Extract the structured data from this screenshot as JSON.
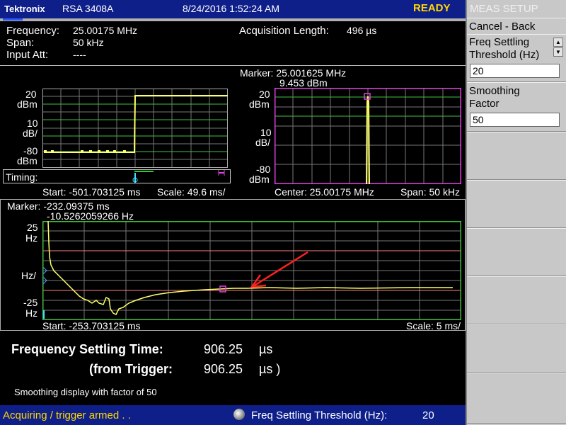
{
  "titlebar": {
    "brand": "Tektronix",
    "model": "RSA 3408A",
    "datetime": "8/24/2016 1:52:24 AM",
    "status": "READY"
  },
  "settings": {
    "frequency_label": "Frequency:",
    "frequency_value": "25.00175 MHz",
    "span_label": "Span:",
    "span_value": "50 kHz",
    "input_att_label": "Input Att:",
    "input_att_value": "----",
    "acq_label": "Acquisition Length:",
    "acq_value": "496 µs"
  },
  "timing_plot": {
    "y_top": "20",
    "y_top_unit": "dBm",
    "y_mid": "10",
    "y_mid_unit": "dB/",
    "y_bot": "-80",
    "y_bot_unit": "dBm",
    "timing_label": "Timing:",
    "start": "Start: -501.703125 ms",
    "scale": "Scale: 49.6 ms/"
  },
  "spectrum_plot": {
    "marker_line1": "Marker: 25.001625 MHz",
    "marker_line2": "9.453 dBm",
    "y_top": "20",
    "y_top_unit": "dBm",
    "y_mid": "10",
    "y_mid_unit": "dB/",
    "y_bot": "-80",
    "y_bot_unit": "dBm",
    "center": "Center: 25.00175 MHz",
    "span": "Span: 50 kHz"
  },
  "settling_plot": {
    "marker_line1": "Marker: -232.09375 ms",
    "marker_line2": "-10.5262059266 Hz",
    "y_top": "25",
    "y_top_unit": "Hz",
    "y_mid_unit": "Hz/",
    "y_bot": "-25",
    "y_bot_unit": "Hz",
    "start": "Start: -253.703125 ms",
    "scale": "Scale: 5 ms/"
  },
  "results": {
    "fst_label": "Frequency Settling Time:",
    "fst_value": "906.25",
    "fst_unit": "µs",
    "trig_label": "(from Trigger:",
    "trig_value": "906.25",
    "trig_unit": "µs )",
    "note": "Smoothing display with factor of 50"
  },
  "side_menu": {
    "header": "MEAS SETUP",
    "cancel": "Cancel - Back",
    "threshold_label_1": "Freq Settling",
    "threshold_label_2": "Threshold (Hz)",
    "threshold_value": "20",
    "smoothing_label_1": "Smoothing",
    "smoothing_label_2": "Factor",
    "smoothing_value": "50"
  },
  "statusbar": {
    "state": "Acquiring / trigger armed . .",
    "param_label": "Freq Settling Threshold (Hz):",
    "param_value": "20"
  },
  "colors": {
    "trace": "#ffff66",
    "grid": "#3fbf3f",
    "marker": "#e040e0",
    "arrow": "#ff2020",
    "titlebar": "#0f1f8a"
  },
  "icons": [
    "knob-icon",
    "spin-up-icon",
    "spin-down-icon",
    "trigger-marker-icon"
  ]
}
